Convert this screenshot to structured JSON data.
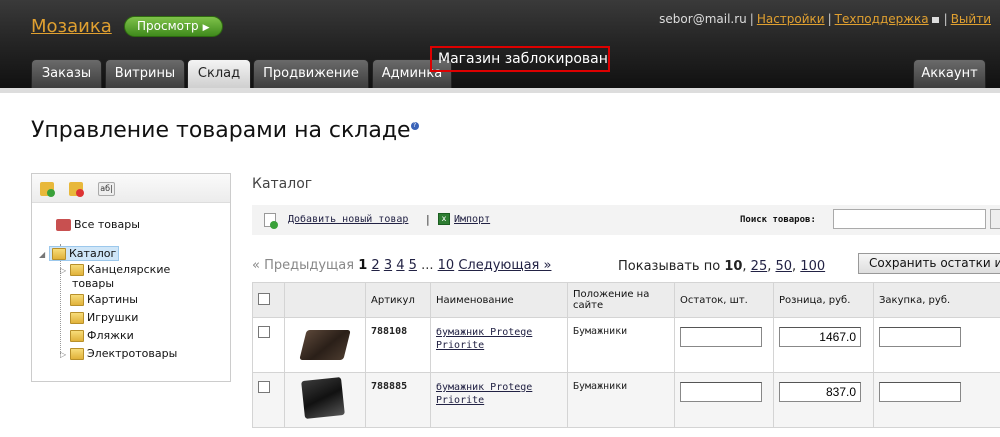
{
  "header": {
    "logo": "Мозаика",
    "preview_button": "Просмотр",
    "user_email": "sebor@mail.ru",
    "links": {
      "settings": "Настройки",
      "support": "Техподдержка",
      "logout": "Выйти"
    },
    "blocked_notice": "Магазин заблокирован",
    "tabs": [
      {
        "label": "Заказы"
      },
      {
        "label": "Витрины"
      },
      {
        "label": "Склад"
      },
      {
        "label": "Продвижение"
      },
      {
        "label": "Админка"
      }
    ],
    "active_tab": "Склад",
    "account_tab": "Аккаунт"
  },
  "page": {
    "title": "Управление товарами на складе",
    "help_icon": "?"
  },
  "tree": {
    "toolbar_rename_label": "аб|",
    "all_goods": "Все товары",
    "catalog": "Каталог",
    "items": [
      {
        "label_line1": "Канцелярские",
        "label_line2": "товары"
      },
      {
        "label": "Картины"
      },
      {
        "label": "Игрушки"
      },
      {
        "label": "Фляжки"
      },
      {
        "label": "Электротовары"
      }
    ]
  },
  "catalog": {
    "label": "Каталог",
    "add_item": "Добавить новый товар",
    "separator": "|",
    "import": "Импорт",
    "search_label": "Поиск товаров:",
    "search_value": ""
  },
  "pager": {
    "prev": "« Предыдущая",
    "current": "1",
    "pages": [
      "2",
      "3",
      "4",
      "5"
    ],
    "ellipsis": "...",
    "last": "10",
    "next": "Следующая »"
  },
  "page_size": {
    "label": "Показывать по",
    "current": "10",
    "options": [
      "25",
      "50",
      "100"
    ]
  },
  "save_button": "Сохранить остатки и",
  "table": {
    "headers": {
      "article": "Артикул",
      "name": "Наименование",
      "position": "Положение на сайте",
      "stock": "Остаток, шт.",
      "retail": "Розница, руб.",
      "purchase": "Закупка, руб."
    },
    "rows": [
      {
        "article": "788108",
        "name": "бумажник Protege Priorite",
        "position": "Бумажники",
        "stock": "",
        "retail": "1467.0",
        "purchase": ""
      },
      {
        "article": "788885",
        "name": "бумажник Protege Priorite",
        "position": "Бумажники",
        "stock": "",
        "retail": "837.0",
        "purchase": ""
      }
    ]
  },
  "colors": {
    "header_bg": "#262626",
    "logo": "#e0a030",
    "preview_green": "#4f9a2a",
    "blocked_border": "#dd0000",
    "link": "#222244"
  },
  "icons": [
    "add-folder-icon",
    "delete-folder-icon",
    "rename-icon",
    "all-goods-icon",
    "folder-icon",
    "add-item-icon",
    "excel-icon",
    "help-icon",
    "mail-icon"
  ]
}
